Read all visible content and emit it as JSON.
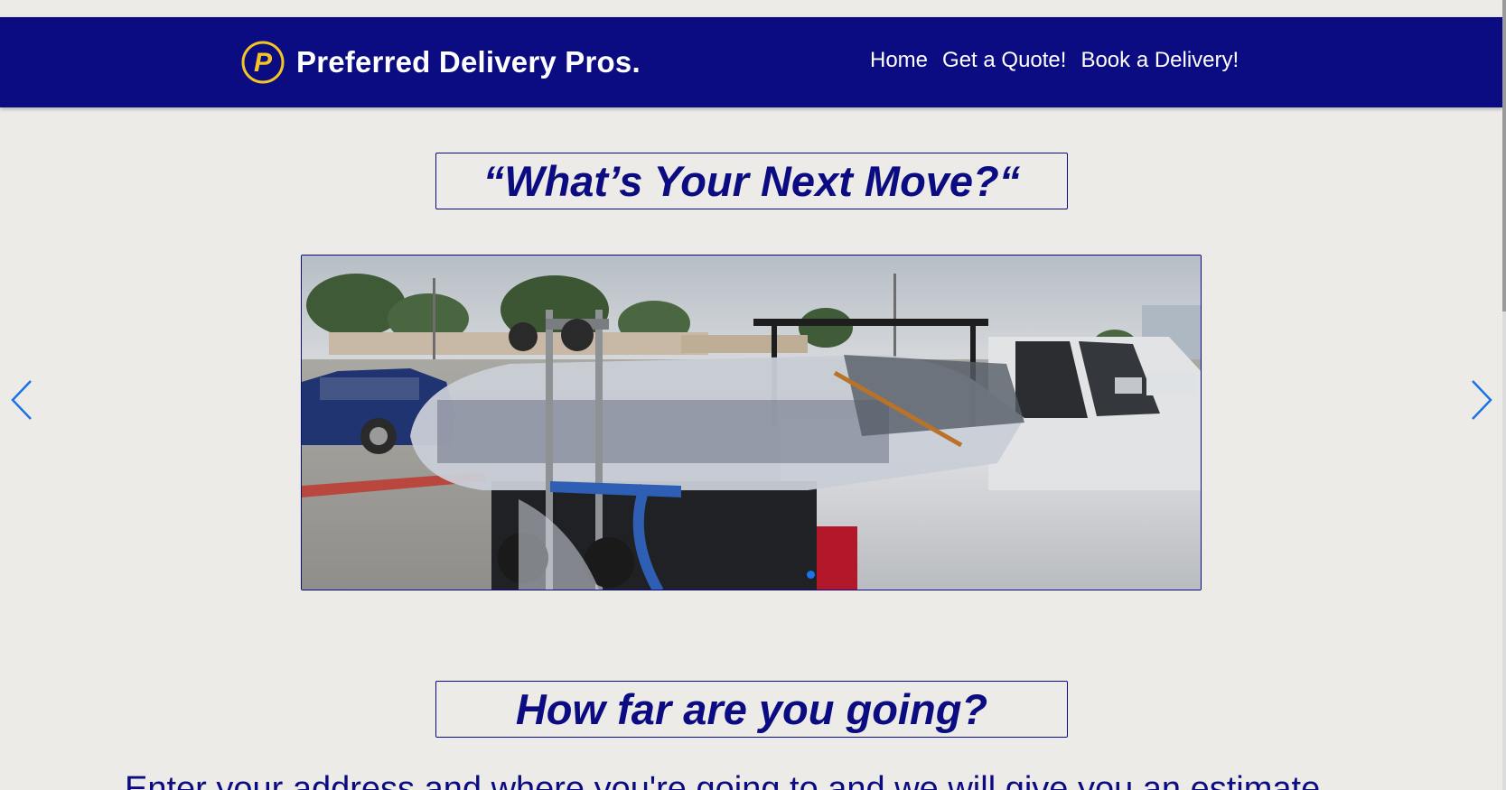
{
  "header": {
    "brand_name": "Preferred Delivery Pros.",
    "logo_letter": "P",
    "nav": {
      "home": "Home",
      "quote": "Get a Quote!",
      "book": "Book a Delivery!"
    }
  },
  "hero": {
    "title": "“What’s Your Next Move?“"
  },
  "carousel": {
    "slide_alt": "Pickup truck loaded with plastic-wrapped mattress and a hand truck in a parking lot",
    "prev_icon": "chevron-left-icon",
    "next_icon": "chevron-right-icon",
    "indicator_count": 1,
    "active_index": 0
  },
  "distance": {
    "title": "How far are you going?",
    "subtext": "Enter your address and where you're going to and we will give you an estimate"
  },
  "colors": {
    "brand": "#0b0b82",
    "background": "#ecebe7",
    "logo_accent": "#f2c524",
    "arrow": "#1a73e8"
  }
}
